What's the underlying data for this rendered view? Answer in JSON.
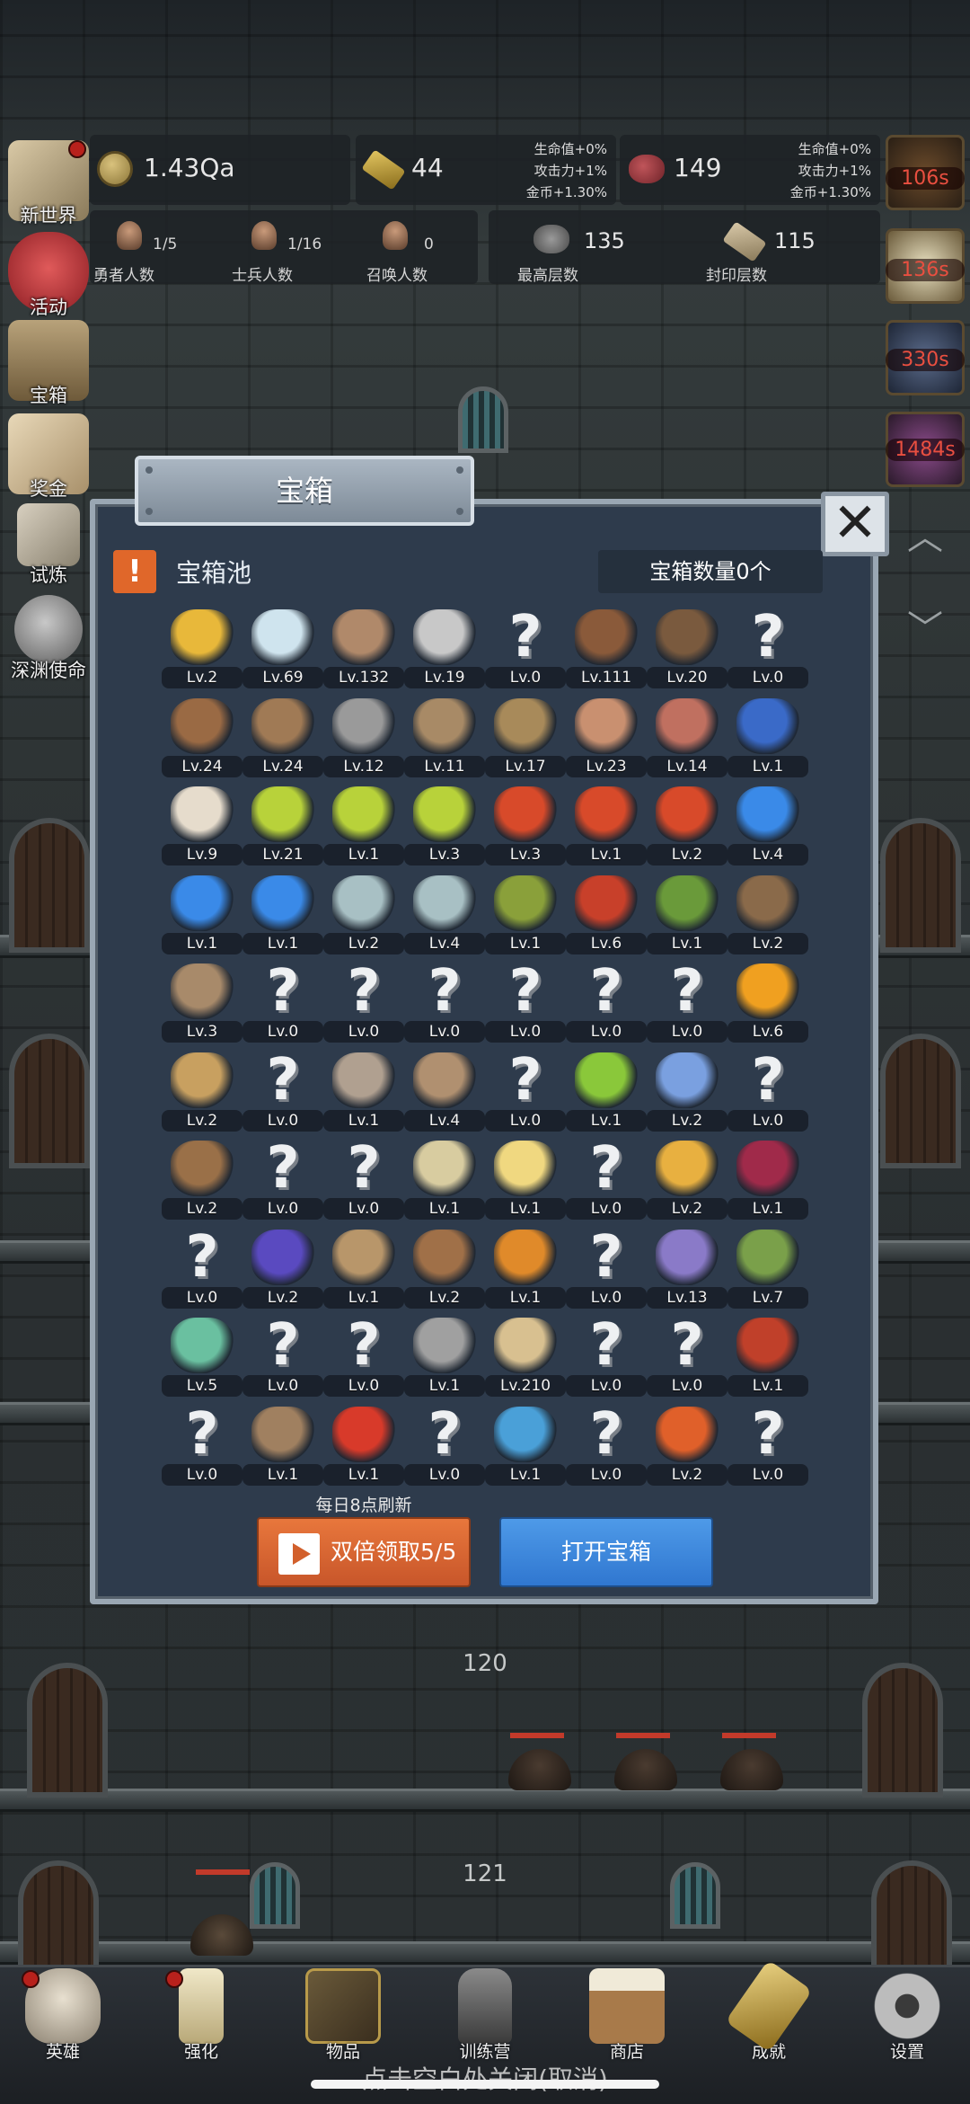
{
  "stats": {
    "gold": "1.43Qa",
    "bars": "44",
    "bars_bonus": [
      "生命值+0%",
      "攻击力+1%",
      "金币+1.30%"
    ],
    "meat": "149",
    "meat_bonus": [
      "生命值+0%",
      "攻击力+1%",
      "金币+1.30%"
    ],
    "heroes": {
      "value": "1/5",
      "label": "勇者人数"
    },
    "soldiers": {
      "value": "1/16",
      "label": "士兵人数"
    },
    "summons": {
      "value": "0",
      "label": "召唤人数"
    },
    "max_floor": {
      "value": "135",
      "label": "最高层数"
    },
    "seal_floor": {
      "value": "115",
      "label": "封印层数"
    }
  },
  "side_menu": [
    {
      "label": "新世界",
      "icon": "map-icon",
      "dot": true
    },
    {
      "label": "活动",
      "icon": "heart-icon",
      "dot": false
    },
    {
      "label": "宝箱",
      "icon": "chest-icon",
      "dot": false
    },
    {
      "label": "奖金",
      "icon": "envelope-icon",
      "dot": false
    },
    {
      "label": "试炼",
      "icon": "feather-icon",
      "dot": false
    },
    {
      "label": "深渊使命",
      "icon": "stone-icon",
      "dot": false
    }
  ],
  "timers": [
    "106s",
    "136s",
    "330s",
    "1484s"
  ],
  "modal": {
    "title": "宝箱",
    "close_symbol": "✕",
    "pool_label": "宝箱池",
    "chest_count": "宝箱数量0个",
    "refresh_note": "每日8点刷新",
    "double_button": "双倍领取5/5",
    "open_button": "打开宝箱"
  },
  "items": [
    [
      "crown-icon",
      "Lv.2"
    ],
    [
      "diamond-icon",
      "Lv.69"
    ],
    [
      "sword-icon",
      "Lv.132"
    ],
    [
      "silver-sword-icon",
      "Lv.19"
    ],
    [
      "unknown-icon",
      "Lv.0"
    ],
    [
      "leather-armor-icon",
      "Lv.111"
    ],
    [
      "backpack-armor-icon",
      "Lv.20"
    ],
    [
      "unknown-icon",
      "Lv.0"
    ],
    [
      "leather-helmet-icon",
      "Lv.24"
    ],
    [
      "wooden-sword-icon",
      "Lv.24"
    ],
    [
      "knight-helmet-icon",
      "Lv.12"
    ],
    [
      "hammer-icon",
      "Lv.11"
    ],
    [
      "great-helm-icon",
      "Lv.17"
    ],
    [
      "ham-icon",
      "Lv.23"
    ],
    [
      "steak-icon",
      "Lv.14"
    ],
    [
      "blue-sack-icon",
      "Lv.1"
    ],
    [
      "bread-icon",
      "Lv.9"
    ],
    [
      "green-potion-icon",
      "Lv.21"
    ],
    [
      "green-potion-icon",
      "Lv.1"
    ],
    [
      "green-potion-icon",
      "Lv.3"
    ],
    [
      "red-potion-icon",
      "Lv.3"
    ],
    [
      "red-potion-icon",
      "Lv.1"
    ],
    [
      "red-potion-icon",
      "Lv.2"
    ],
    [
      "blue-potion-icon",
      "Lv.4"
    ],
    [
      "blue-potion-icon",
      "Lv.1"
    ],
    [
      "blue-potion-icon",
      "Lv.1"
    ],
    [
      "empty-bottle-icon",
      "Lv.2"
    ],
    [
      "empty-bottle-icon",
      "Lv.4"
    ],
    [
      "green-bottle-icon",
      "Lv.1"
    ],
    [
      "red-bottle-icon",
      "Lv.6"
    ],
    [
      "winged-boot-icon",
      "Lv.1"
    ],
    [
      "boot-icon",
      "Lv.2"
    ],
    [
      "shoe-icon",
      "Lv.3"
    ],
    [
      "unknown-icon",
      "Lv.0"
    ],
    [
      "unknown-icon",
      "Lv.0"
    ],
    [
      "unknown-icon",
      "Lv.0"
    ],
    [
      "unknown-icon",
      "Lv.0"
    ],
    [
      "unknown-icon",
      "Lv.0"
    ],
    [
      "unknown-icon",
      "Lv.0"
    ],
    [
      "torch-icon",
      "Lv.6"
    ],
    [
      "wand-icon",
      "Lv.2"
    ],
    [
      "unknown-icon",
      "Lv.0"
    ],
    [
      "pickaxe-icon",
      "Lv.1"
    ],
    [
      "staff-icon",
      "Lv.4"
    ],
    [
      "unknown-icon",
      "Lv.0"
    ],
    [
      "lime-icon",
      "Lv.1"
    ],
    [
      "blue-wand-icon",
      "Lv.2"
    ],
    [
      "unknown-icon",
      "Lv.0"
    ],
    [
      "bag-icon",
      "Lv.2"
    ],
    [
      "unknown-icon",
      "Lv.0"
    ],
    [
      "unknown-icon",
      "Lv.0"
    ],
    [
      "club-icon",
      "Lv.1"
    ],
    [
      "cheese-icon",
      "Lv.1"
    ],
    [
      "unknown-icon",
      "Lv.0"
    ],
    [
      "honey-jar-icon",
      "Lv.2"
    ],
    [
      "crystal-icon",
      "Lv.1"
    ],
    [
      "unknown-icon",
      "Lv.0"
    ],
    [
      "magic-orb-icon",
      "Lv.2"
    ],
    [
      "bow-icon",
      "Lv.1"
    ],
    [
      "quiver-icon",
      "Lv.2"
    ],
    [
      "gauntlet-icon",
      "Lv.1"
    ],
    [
      "unknown-icon",
      "Lv.0"
    ],
    [
      "tentacle-icon",
      "Lv.13"
    ],
    [
      "emblem-icon",
      "Lv.7"
    ],
    [
      "rainbow-gem-icon",
      "Lv.5"
    ],
    [
      "unknown-icon",
      "Lv.0"
    ],
    [
      "unknown-icon",
      "Lv.0"
    ],
    [
      "green-staff-icon",
      "Lv.1"
    ],
    [
      "beer-mug-icon",
      "Lv.210"
    ],
    [
      "unknown-icon",
      "Lv.0"
    ],
    [
      "unknown-icon",
      "Lv.0"
    ],
    [
      "spellbook-icon",
      "Lv.1"
    ],
    [
      "unknown-icon",
      "Lv.0"
    ],
    [
      "whip-icon",
      "Lv.1"
    ],
    [
      "card-icon",
      "Lv.1"
    ],
    [
      "unknown-icon",
      "Lv.0"
    ],
    [
      "rune-shield-icon",
      "Lv.1"
    ],
    [
      "unknown-icon",
      "Lv.0"
    ],
    [
      "fire-wand-icon",
      "Lv.2"
    ],
    [
      "unknown-icon",
      "Lv.0"
    ]
  ],
  "floors": [
    "120",
    "121"
  ],
  "bottom_nav": [
    {
      "label": "英雄",
      "icon": "skull-icon",
      "dot": true
    },
    {
      "label": "强化",
      "icon": "candle-icon",
      "dot": true
    },
    {
      "label": "物品",
      "icon": "book-icon",
      "dot": false
    },
    {
      "label": "训练营",
      "icon": "lantern-icon",
      "dot": false
    },
    {
      "label": "商店",
      "icon": "beer-icon",
      "dot": false
    },
    {
      "label": "成就",
      "icon": "key-icon",
      "dot": false
    },
    {
      "label": "设置",
      "icon": "gear-icon",
      "dot": false
    }
  ],
  "close_hint": "点击空白处关闭(取消)",
  "colors": {
    "accent_orange": "#d86230",
    "accent_blue": "#3d89de",
    "panel": "#2e3b4c"
  }
}
